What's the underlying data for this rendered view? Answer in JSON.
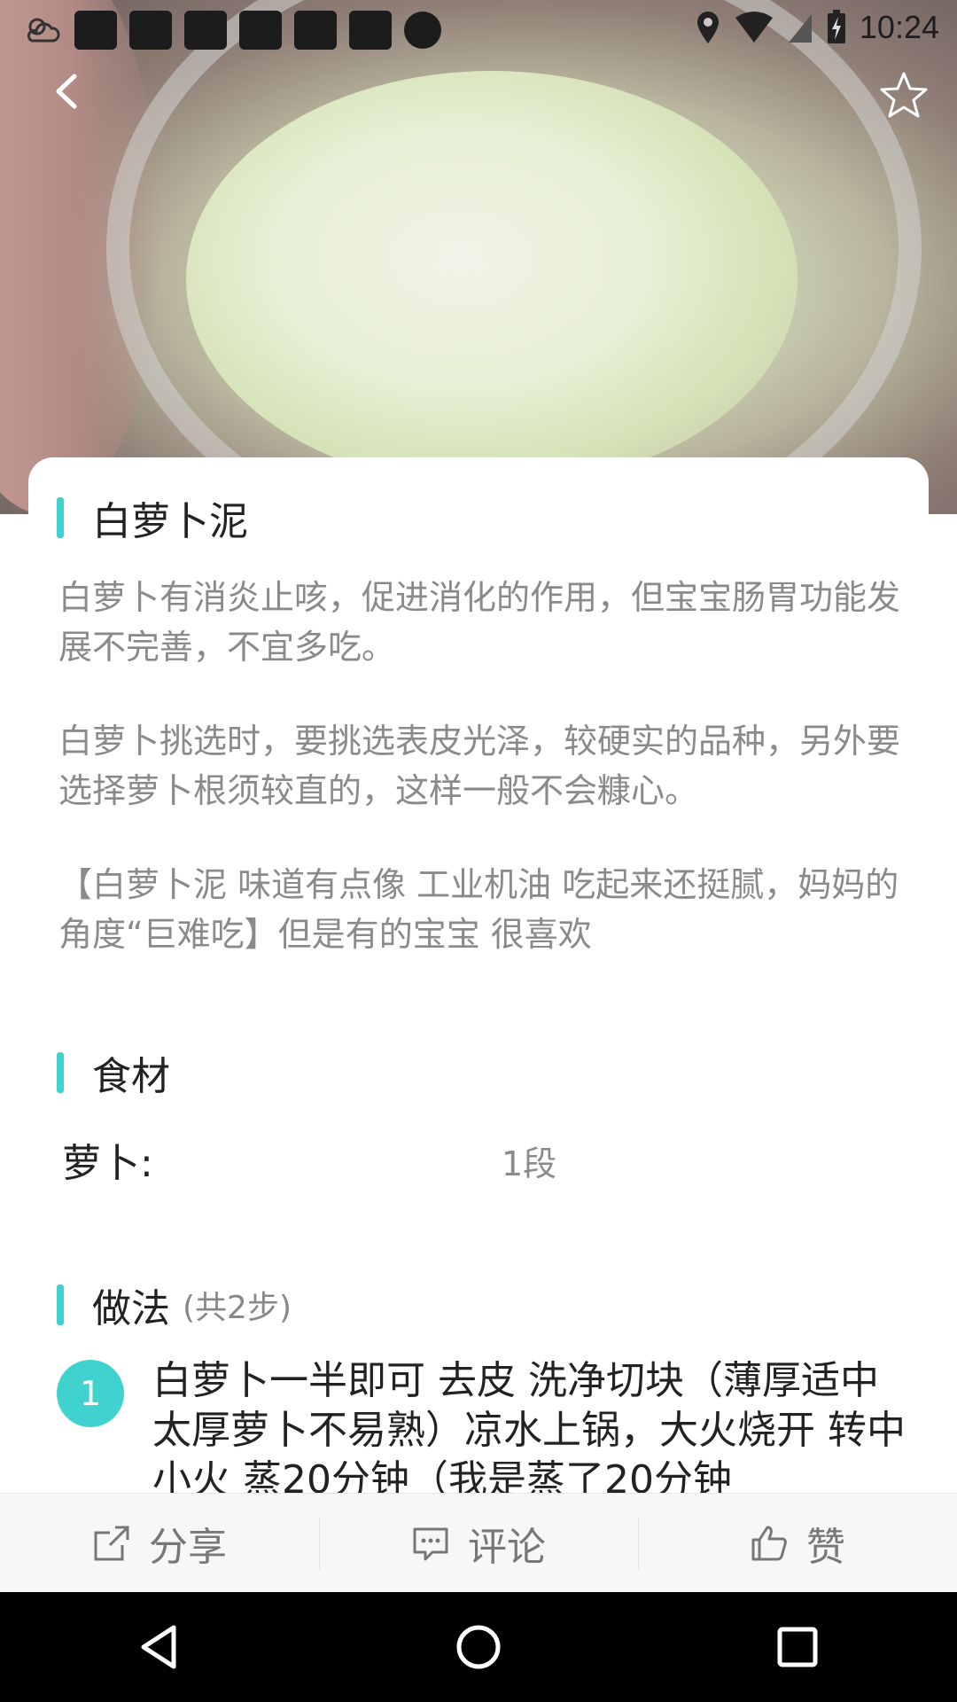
{
  "status_bar": {
    "time": "10:24"
  },
  "recipe": {
    "title": "白萝卜泥",
    "desc": [
      "白萝卜有消炎止咳，促进消化的作用，但宝宝肠胃功能发展不完善，不宜多吃。",
      "白萝卜挑选时，要挑选表皮光泽，较硬实的品种，另外要选择萝卜根须较直的，这样一般不会糠心。",
      "【白萝卜泥 味道有点像 工业机油 吃起来还挺腻，妈妈的角度“巨难吃】但是有的宝宝 很喜欢"
    ],
    "ingredients_title": "食材",
    "ingredients": [
      {
        "name": "萝卜:",
        "qty": "1段"
      }
    ],
    "steps_title": "做法",
    "steps_count": "(共2步)",
    "steps": [
      {
        "num": "1",
        "text": "白萝卜一半即可 去皮 洗净切块（薄厚适中 太厚萝卜不易熟）凉水上锅，大火烧开 转中小火 蒸20分钟（我是蒸了20分钟"
      }
    ]
  },
  "actions": {
    "share": "分享",
    "comment": "评论",
    "like": "赞"
  },
  "colors": {
    "accent": "#3fd2cf"
  }
}
